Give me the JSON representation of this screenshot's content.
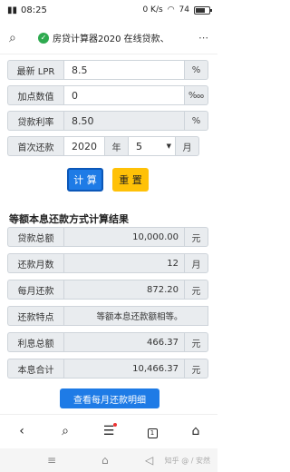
{
  "status": {
    "carrier": "all",
    "time": "08:25",
    "network_speed": "0 K/s",
    "battery": "74",
    "battery_fraction": 0.74
  },
  "address": {
    "page_title": "房贷计算器2020 在线贷款、"
  },
  "form": {
    "lpr": {
      "label": "最新 LPR",
      "value": "8.5",
      "unit": "%"
    },
    "bp": {
      "label": "加点数值",
      "value": "0",
      "unit": "‱"
    },
    "rate": {
      "label": "贷款利率",
      "value": "8.50",
      "unit": "%"
    },
    "first": {
      "label": "首次还款",
      "year": "2020",
      "year_unit": "年",
      "month": "5",
      "month_unit": "月"
    }
  },
  "buttons": {
    "calc": "计 算",
    "reset": "重 置"
  },
  "results_title": "等额本息还款方式计算结果",
  "results": [
    {
      "label": "贷款总额",
      "value": "10,000.00",
      "unit": "元"
    },
    {
      "label": "还款月数",
      "value": "12",
      "unit": "月"
    },
    {
      "label": "每月还款",
      "value": "872.20",
      "unit": "元"
    },
    {
      "label": "还款特点",
      "value": "等额本息还款额相等。",
      "unit": ""
    },
    {
      "label": "利息总额",
      "value": "466.37",
      "unit": "元"
    },
    {
      "label": "本息合计",
      "value": "10,466.37",
      "unit": "元"
    }
  ],
  "detail_button": "查看每月还款明细",
  "bottom_nav": {
    "tabs_count": "1"
  },
  "watermark": "知乎 @ / 安然"
}
